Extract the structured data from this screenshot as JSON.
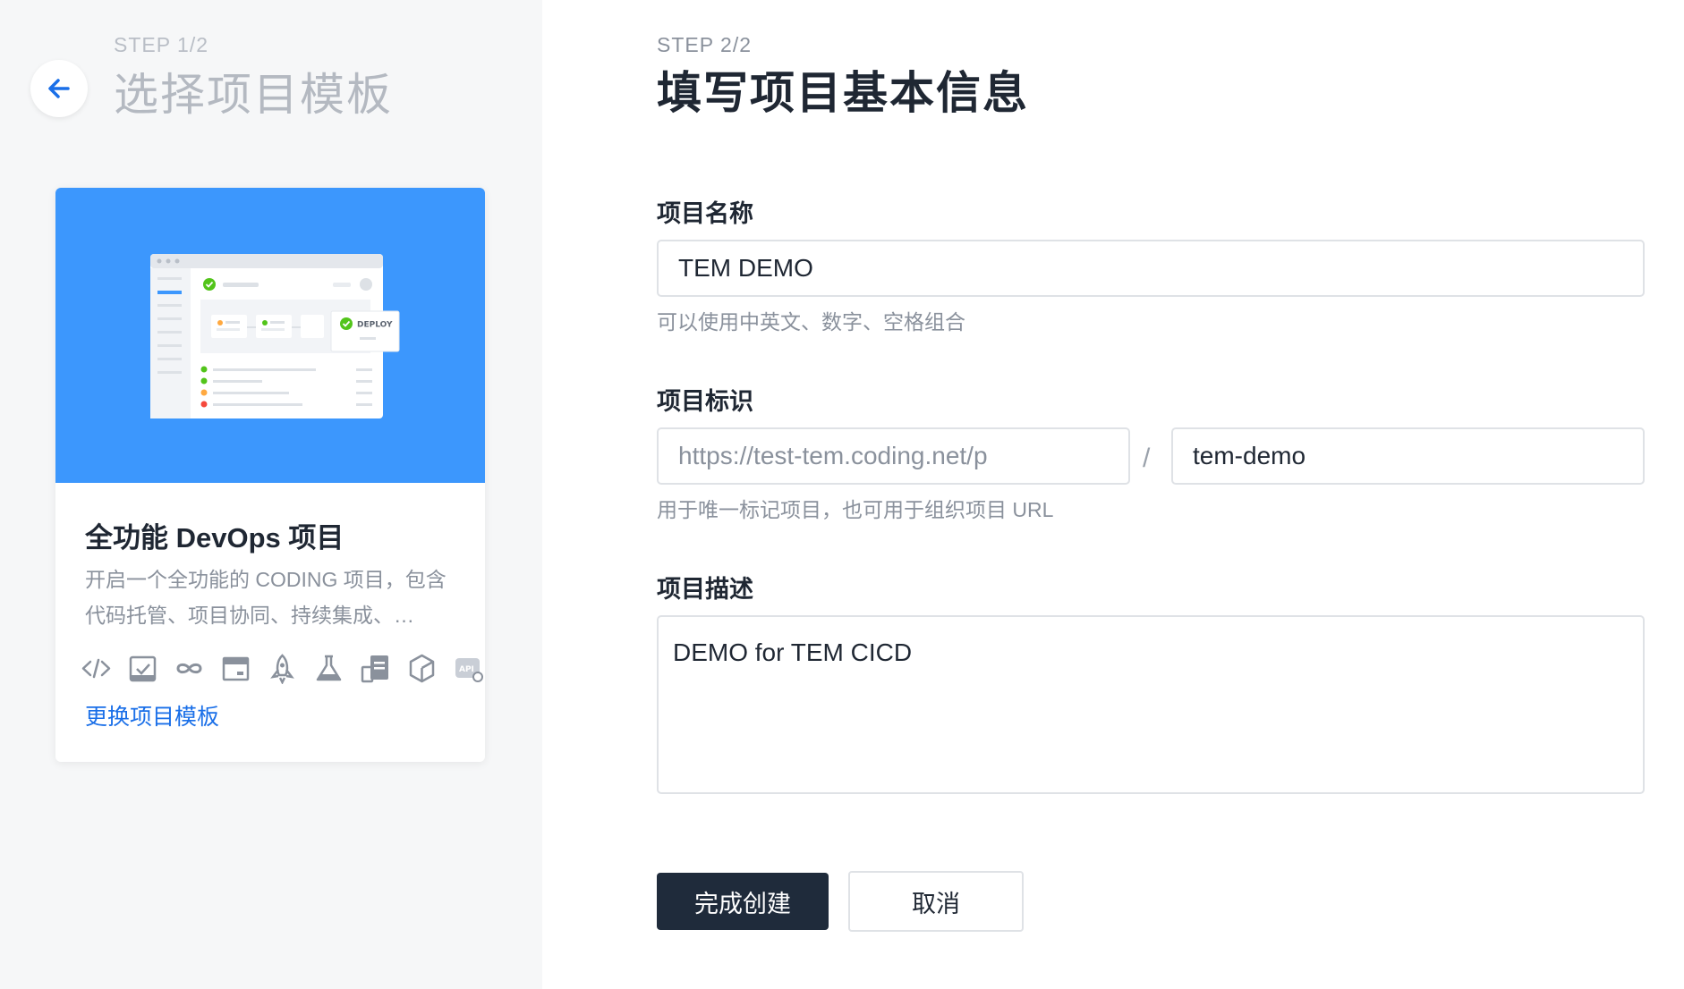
{
  "step1": {
    "step_label": "STEP 1/2",
    "title": "选择项目模板"
  },
  "template_card": {
    "preview_badge": "DEPLOY",
    "title": "全功能 DevOps 项目",
    "description": "开启一个全功能的 CODING 项目，包含代码托管、项目协同、持续集成、…",
    "feature_icons": [
      "code-icon",
      "task-check-icon",
      "infinity-icon",
      "artifact-icon",
      "rocket-icon",
      "test-flask-icon",
      "docs-icon",
      "package-icon",
      "api-icon"
    ],
    "change_link": "更换项目模板"
  },
  "step2": {
    "step_label": "STEP 2/2",
    "title": "填写项目基本信息"
  },
  "form": {
    "name": {
      "label": "项目名称",
      "value": "TEM DEMO",
      "hint": "可以使用中英文、数字、空格组合"
    },
    "identifier": {
      "label": "项目标识",
      "url_prefix": "https://test-tem.coding.net/p",
      "separator": "/",
      "value": "tem-demo",
      "hint": "用于唯一标记项目，也可用于组织项目 URL"
    },
    "description": {
      "label": "项目描述",
      "value": "DEMO for TEM CICD"
    }
  },
  "buttons": {
    "submit": "完成创建",
    "cancel": "取消"
  },
  "colors": {
    "primary": "#1f2b3b",
    "link": "#1a6fe8",
    "banner": "#3c97fd",
    "success": "#52c41a"
  }
}
